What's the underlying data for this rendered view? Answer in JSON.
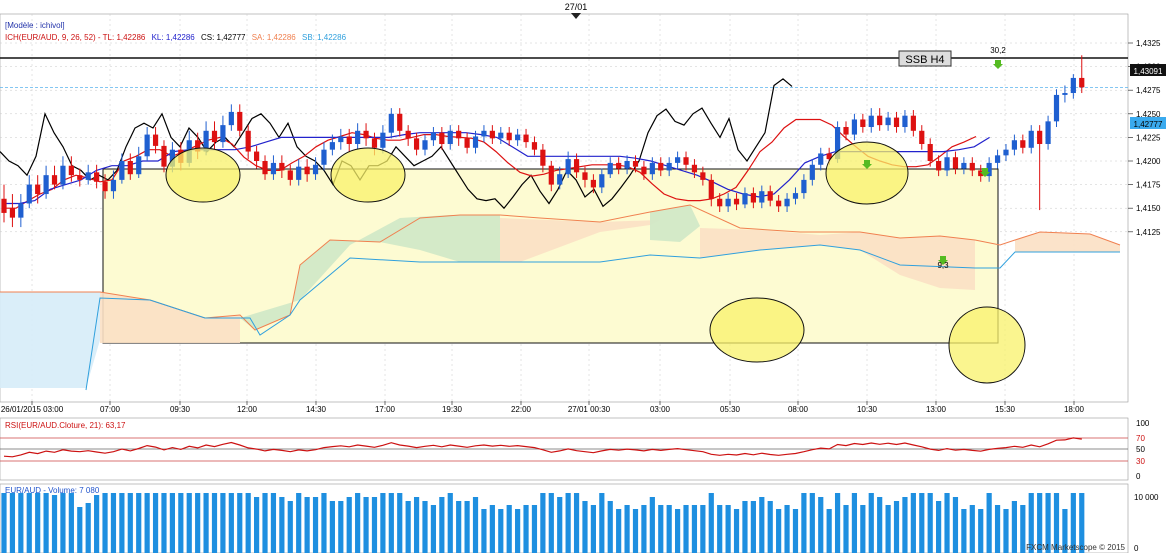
{
  "header": {
    "date_label": "27/01",
    "model_label": "[Modèle : ichivol]",
    "ich_prefix": "ICH(EUR/AUD, 9, 26, 52) - ",
    "tl": "TL: 1,42286",
    "kl": "KL: 1,42286",
    "cs": "CS: 1,42777",
    "sa": "SA: 1,42286",
    "sb": "SB: 1,42286"
  },
  "annotations": {
    "ssb_label": "SSB H4",
    "ssb_level_tag": "1,43091",
    "last_price_tag": "1,42777",
    "marker_high": "30,2",
    "marker_low": "9,3"
  },
  "rsi": {
    "label": "RSI(EUR/AUD.Cloture, 21): 63,17",
    "ticks": [
      "100",
      "70",
      "50",
      "30",
      "0"
    ]
  },
  "volume": {
    "label": "EUR/AUD - Volume: 7 080",
    "tick": "10 000",
    "tick_zero": "0"
  },
  "footer": {
    "brand": "FXCM Marketscope © 2015"
  },
  "colors": {
    "up": "#1f5fd0",
    "down": "#dd1111",
    "tenkan": "#dd1111",
    "kijun": "#2222cc",
    "chikou": "#000000",
    "senkou_a": "#f08050",
    "senkou_b": "#30a0dd",
    "cloud_green": "#cfe8c6",
    "cloud_orange": "#fbe0c4",
    "cloud_blue": "#d6ecf8",
    "highlight_box": "#fdfbd2",
    "circle_fill": "#f8f26a",
    "rsi": "#cc1111"
  },
  "chart_data": {
    "type": "candlestick",
    "title": "",
    "x_tick_labels": [
      "26/01/2015 03:00",
      "07:00",
      "09:30",
      "12:00",
      "14:30",
      "17:00",
      "19:30",
      "22:00",
      "27/01 00:30",
      "03:00",
      "05:30",
      "08:00",
      "10:30",
      "13:00",
      "15:30",
      "18:00"
    ],
    "y_tick_labels": [
      "1,4325",
      "1,4300",
      "1,4275",
      "1,4250",
      "1,4225",
      "1,4200",
      "1,4175",
      "1,4150",
      "1,4125"
    ],
    "ylim": [
      1.411,
      1.4335
    ],
    "ssb_h4_level": 1.43091,
    "last_close": 1.42777,
    "candles": [
      [
        1.416,
        1.4145,
        1.4175,
        1.4135
      ],
      [
        1.415,
        1.414,
        1.4165,
        1.413
      ],
      [
        1.414,
        1.4155,
        1.4165,
        1.413
      ],
      [
        1.4155,
        1.4175,
        1.4185,
        1.415
      ],
      [
        1.4175,
        1.4165,
        1.4185,
        1.4155
      ],
      [
        1.4165,
        1.4185,
        1.4195,
        1.416
      ],
      [
        1.4185,
        1.4175,
        1.4195,
        1.417
      ],
      [
        1.4175,
        1.4195,
        1.4205,
        1.417
      ],
      [
        1.4195,
        1.4185,
        1.4205,
        1.4178
      ],
      [
        1.4185,
        1.418,
        1.4192,
        1.4173
      ],
      [
        1.418,
        1.4188,
        1.4196,
        1.4175
      ],
      [
        1.4188,
        1.4178,
        1.4196,
        1.4171
      ],
      [
        1.4178,
        1.4168,
        1.4186,
        1.416
      ],
      [
        1.4168,
        1.418,
        1.419,
        1.416
      ],
      [
        1.418,
        1.42,
        1.4208,
        1.4176
      ],
      [
        1.42,
        1.4186,
        1.4208,
        1.418
      ],
      [
        1.4186,
        1.4205,
        1.4215,
        1.4182
      ],
      [
        1.4205,
        1.4228,
        1.4236,
        1.42
      ],
      [
        1.4228,
        1.4216,
        1.4236,
        1.4208
      ],
      [
        1.4216,
        1.4194,
        1.4222,
        1.4188
      ],
      [
        1.4194,
        1.4212,
        1.422,
        1.4188
      ],
      [
        1.4212,
        1.4198,
        1.422,
        1.419
      ],
      [
        1.4198,
        1.4222,
        1.4232,
        1.4194
      ],
      [
        1.4222,
        1.421,
        1.423,
        1.4202
      ],
      [
        1.421,
        1.4232,
        1.4242,
        1.4206
      ],
      [
        1.4232,
        1.422,
        1.4242,
        1.4212
      ],
      [
        1.422,
        1.4238,
        1.4248,
        1.4214
      ],
      [
        1.4238,
        1.4252,
        1.426,
        1.4232
      ],
      [
        1.4252,
        1.4232,
        1.426,
        1.4226
      ],
      [
        1.4232,
        1.421,
        1.4238,
        1.4202
      ],
      [
        1.421,
        1.42,
        1.4216,
        1.4192
      ],
      [
        1.42,
        1.4186,
        1.4206,
        1.418
      ],
      [
        1.4186,
        1.4198,
        1.4206,
        1.418
      ],
      [
        1.4198,
        1.419,
        1.4206,
        1.4182
      ],
      [
        1.419,
        1.418,
        1.4196,
        1.4174
      ],
      [
        1.418,
        1.4194,
        1.4202,
        1.4174
      ],
      [
        1.4194,
        1.4186,
        1.4202,
        1.4178
      ],
      [
        1.4186,
        1.4196,
        1.4204,
        1.418
      ],
      [
        1.4196,
        1.4212,
        1.422,
        1.419
      ],
      [
        1.4212,
        1.422,
        1.4228,
        1.4206
      ],
      [
        1.422,
        1.4226,
        1.4234,
        1.4212
      ],
      [
        1.4226,
        1.4218,
        1.4234,
        1.421
      ],
      [
        1.4218,
        1.4232,
        1.424,
        1.4212
      ],
      [
        1.4232,
        1.4224,
        1.424,
        1.4216
      ],
      [
        1.4224,
        1.4214,
        1.423,
        1.4206
      ],
      [
        1.4214,
        1.423,
        1.4238,
        1.4208
      ],
      [
        1.423,
        1.425,
        1.4256,
        1.4224
      ],
      [
        1.425,
        1.4232,
        1.4256,
        1.4226
      ],
      [
        1.4232,
        1.4224,
        1.4238,
        1.4216
      ],
      [
        1.4224,
        1.4212,
        1.423,
        1.4206
      ],
      [
        1.4212,
        1.4222,
        1.4228,
        1.4206
      ],
      [
        1.4222,
        1.423,
        1.4236,
        1.4216
      ],
      [
        1.423,
        1.4218,
        1.4236,
        1.4212
      ],
      [
        1.4218,
        1.4232,
        1.4238,
        1.4212
      ],
      [
        1.4232,
        1.4224,
        1.4238,
        1.4216
      ],
      [
        1.4224,
        1.4214,
        1.423,
        1.4208
      ],
      [
        1.4214,
        1.4226,
        1.4232,
        1.4208
      ],
      [
        1.4226,
        1.4232,
        1.4238,
        1.422
      ],
      [
        1.4232,
        1.4224,
        1.4238,
        1.4218
      ],
      [
        1.4224,
        1.423,
        1.4236,
        1.4218
      ],
      [
        1.423,
        1.4222,
        1.4236,
        1.4216
      ],
      [
        1.4222,
        1.4228,
        1.4234,
        1.4216
      ],
      [
        1.4228,
        1.422,
        1.4234,
        1.4214
      ],
      [
        1.422,
        1.4212,
        1.4226,
        1.4206
      ],
      [
        1.4212,
        1.4195,
        1.4218,
        1.4188
      ],
      [
        1.4195,
        1.4175,
        1.42,
        1.4168
      ],
      [
        1.4175,
        1.4186,
        1.4194,
        1.417
      ],
      [
        1.4186,
        1.4202,
        1.421,
        1.4182
      ],
      [
        1.4202,
        1.4188,
        1.4208,
        1.4182
      ],
      [
        1.4188,
        1.418,
        1.4194,
        1.4172
      ],
      [
        1.418,
        1.4172,
        1.4186,
        1.4166
      ],
      [
        1.4172,
        1.4186,
        1.4192,
        1.4166
      ],
      [
        1.4186,
        1.4198,
        1.4204,
        1.4182
      ],
      [
        1.4198,
        1.4192,
        1.4204,
        1.4186
      ],
      [
        1.4192,
        1.42,
        1.4206,
        1.4186
      ],
      [
        1.42,
        1.4194,
        1.4206,
        1.4188
      ],
      [
        1.4194,
        1.4186,
        1.42,
        1.418
      ],
      [
        1.4186,
        1.4198,
        1.4204,
        1.418
      ],
      [
        1.4198,
        1.419,
        1.4204,
        1.4184
      ],
      [
        1.419,
        1.4198,
        1.4204,
        1.4184
      ],
      [
        1.4198,
        1.4204,
        1.421,
        1.4192
      ],
      [
        1.4204,
        1.4196,
        1.421,
        1.419
      ],
      [
        1.4196,
        1.4188,
        1.4202,
        1.4182
      ],
      [
        1.4188,
        1.418,
        1.4194,
        1.4174
      ],
      [
        1.418,
        1.416,
        1.4186,
        1.4152
      ],
      [
        1.416,
        1.4152,
        1.4166,
        1.4146
      ],
      [
        1.4152,
        1.416,
        1.4166,
        1.4146
      ],
      [
        1.416,
        1.4154,
        1.4166,
        1.4148
      ],
      [
        1.4154,
        1.4166,
        1.4172,
        1.415
      ],
      [
        1.4166,
        1.4156,
        1.4172,
        1.415
      ],
      [
        1.4156,
        1.4168,
        1.4174,
        1.415
      ],
      [
        1.4168,
        1.4158,
        1.4174,
        1.4152
      ],
      [
        1.4158,
        1.4152,
        1.4164,
        1.4146
      ],
      [
        1.4152,
        1.416,
        1.4166,
        1.4146
      ],
      [
        1.416,
        1.4166,
        1.4172,
        1.4154
      ],
      [
        1.4166,
        1.418,
        1.4186,
        1.416
      ],
      [
        1.418,
        1.4196,
        1.4202,
        1.4174
      ],
      [
        1.4196,
        1.4208,
        1.4214,
        1.419
      ],
      [
        1.4208,
        1.4202,
        1.4214,
        1.4196
      ],
      [
        1.4202,
        1.4236,
        1.4242,
        1.4198
      ],
      [
        1.4236,
        1.4228,
        1.4242,
        1.4222
      ],
      [
        1.4228,
        1.4244,
        1.425,
        1.4222
      ],
      [
        1.4244,
        1.4236,
        1.425,
        1.423
      ],
      [
        1.4236,
        1.4248,
        1.4256,
        1.423
      ],
      [
        1.4248,
        1.4238,
        1.4256,
        1.4232
      ],
      [
        1.4238,
        1.4246,
        1.4252,
        1.4232
      ],
      [
        1.4246,
        1.4236,
        1.4252,
        1.423
      ],
      [
        1.4236,
        1.4248,
        1.4254,
        1.423
      ],
      [
        1.4248,
        1.4232,
        1.4254,
        1.4226
      ],
      [
        1.4232,
        1.4218,
        1.4238,
        1.4212
      ],
      [
        1.4218,
        1.42,
        1.4224,
        1.4194
      ],
      [
        1.42,
        1.419,
        1.4206,
        1.4184
      ],
      [
        1.419,
        1.4204,
        1.421,
        1.4184
      ],
      [
        1.4204,
        1.4192,
        1.421,
        1.4186
      ],
      [
        1.4192,
        1.4198,
        1.4204,
        1.4186
      ],
      [
        1.4198,
        1.419,
        1.4204,
        1.4184
      ],
      [
        1.419,
        1.4184,
        1.4196,
        1.4178
      ],
      [
        1.4184,
        1.4198,
        1.4204,
        1.4178
      ],
      [
        1.4198,
        1.4206,
        1.4212,
        1.4192
      ],
      [
        1.4206,
        1.4212,
        1.4218,
        1.42
      ],
      [
        1.4212,
        1.4222,
        1.4228,
        1.4206
      ],
      [
        1.4222,
        1.4214,
        1.4228,
        1.4208
      ],
      [
        1.4214,
        1.4232,
        1.4238,
        1.4208
      ],
      [
        1.4232,
        1.4218,
        1.4238,
        1.4148
      ],
      [
        1.4218,
        1.4242,
        1.4248,
        1.4212
      ],
      [
        1.4242,
        1.427,
        1.4276,
        1.4236
      ],
      [
        1.427,
        1.4272,
        1.428,
        1.4262
      ],
      [
        1.4272,
        1.4288,
        1.4292,
        1.4266
      ],
      [
        1.4288,
        1.4278,
        1.4312,
        1.4272
      ]
    ],
    "tenkan_sen": [
      1.415,
      1.415,
      1.4158,
      1.4165,
      1.417,
      1.418,
      1.4185,
      1.4182,
      1.4178,
      1.418,
      1.42,
      1.4205,
      1.4212,
      1.4212,
      1.4205,
      1.421,
      1.4216,
      1.4222,
      1.4225,
      1.4218,
      1.4204,
      1.4195,
      1.419,
      1.419,
      1.4198,
      1.4205,
      1.4215,
      1.4222,
      1.4226,
      1.423,
      1.4228,
      1.4224,
      1.4222,
      1.4222,
      1.4225,
      1.4228,
      1.4228,
      1.4226,
      1.4225,
      1.4224,
      1.422,
      1.421,
      1.4198,
      1.4188,
      1.4184,
      1.4186,
      1.419,
      1.4192,
      1.4194,
      1.4196,
      1.4196,
      1.4196,
      1.4194,
      1.4188,
      1.4176,
      1.4165,
      1.416,
      1.4158,
      1.4158,
      1.416,
      1.4165,
      1.4172,
      1.419,
      1.421,
      1.422,
      1.4235,
      1.4244,
      1.4244,
      1.4244,
      1.4238,
      1.4226,
      1.4215,
      1.4205,
      1.42,
      1.4196,
      1.4194,
      1.4194,
      1.4196,
      1.4205,
      1.4215,
      1.422,
      1.4226
    ],
    "kijun_sen": [
      1.4155,
      1.4155,
      1.4158,
      1.417,
      1.4175,
      1.418,
      1.419,
      1.4195,
      1.4195,
      1.42,
      1.42,
      1.421,
      1.4212,
      1.4212,
      1.4212,
      1.4212,
      1.4215,
      1.422,
      1.4225,
      1.4225,
      1.4225,
      1.4225,
      1.4225,
      1.4225,
      1.4225,
      1.4225,
      1.4228,
      1.423,
      1.423,
      1.423,
      1.423,
      1.4228,
      1.4225,
      1.4215,
      1.4205,
      1.4205,
      1.4205,
      1.4205,
      1.4205,
      1.4205,
      1.4205,
      1.4203,
      1.42,
      1.4195,
      1.419,
      1.4185,
      1.4178,
      1.417,
      1.4165,
      1.4162,
      1.4165,
      1.418,
      1.4198,
      1.4205,
      1.421,
      1.421,
      1.421,
      1.421,
      1.421,
      1.421,
      1.421,
      1.421,
      1.4212,
      1.4215,
      1.4225
    ],
    "chikou_span": [
      1.421,
      1.42,
      1.4195,
      1.4185,
      1.4205,
      1.425,
      1.423,
      1.4215,
      1.4195,
      1.419,
      1.418,
      1.4185,
      1.418,
      1.419,
      1.4215,
      1.4235,
      1.424,
      1.4235,
      1.425,
      1.4225,
      1.4215,
      1.4235,
      1.4225,
      1.421,
      1.422,
      1.4225,
      1.4215,
      1.423,
      1.4245,
      1.425,
      1.424,
      1.4225,
      1.424,
      1.4215,
      1.4205,
      1.42,
      1.419,
      1.4175,
      1.42,
      1.4195,
      1.418,
      1.4195,
      1.4195,
      1.42,
      1.4215,
      1.4205,
      1.4195,
      1.42,
      1.4205,
      1.4215,
      1.42,
      1.4185,
      1.417,
      1.416,
      1.4158,
      1.416,
      1.415,
      1.4162,
      1.4175,
      1.4185,
      1.4168,
      1.4155,
      1.417,
      1.419,
      1.418,
      1.4162,
      1.417,
      1.4152,
      1.416,
      1.4172,
      1.4185,
      1.42,
      1.423,
      1.4248,
      1.4255,
      1.4242,
      1.4238,
      1.425,
      1.4256,
      1.424,
      1.4225,
      1.4245,
      1.4212,
      1.42,
      1.4215,
      1.423,
      1.428,
      1.4287,
      1.4279
    ]
  }
}
